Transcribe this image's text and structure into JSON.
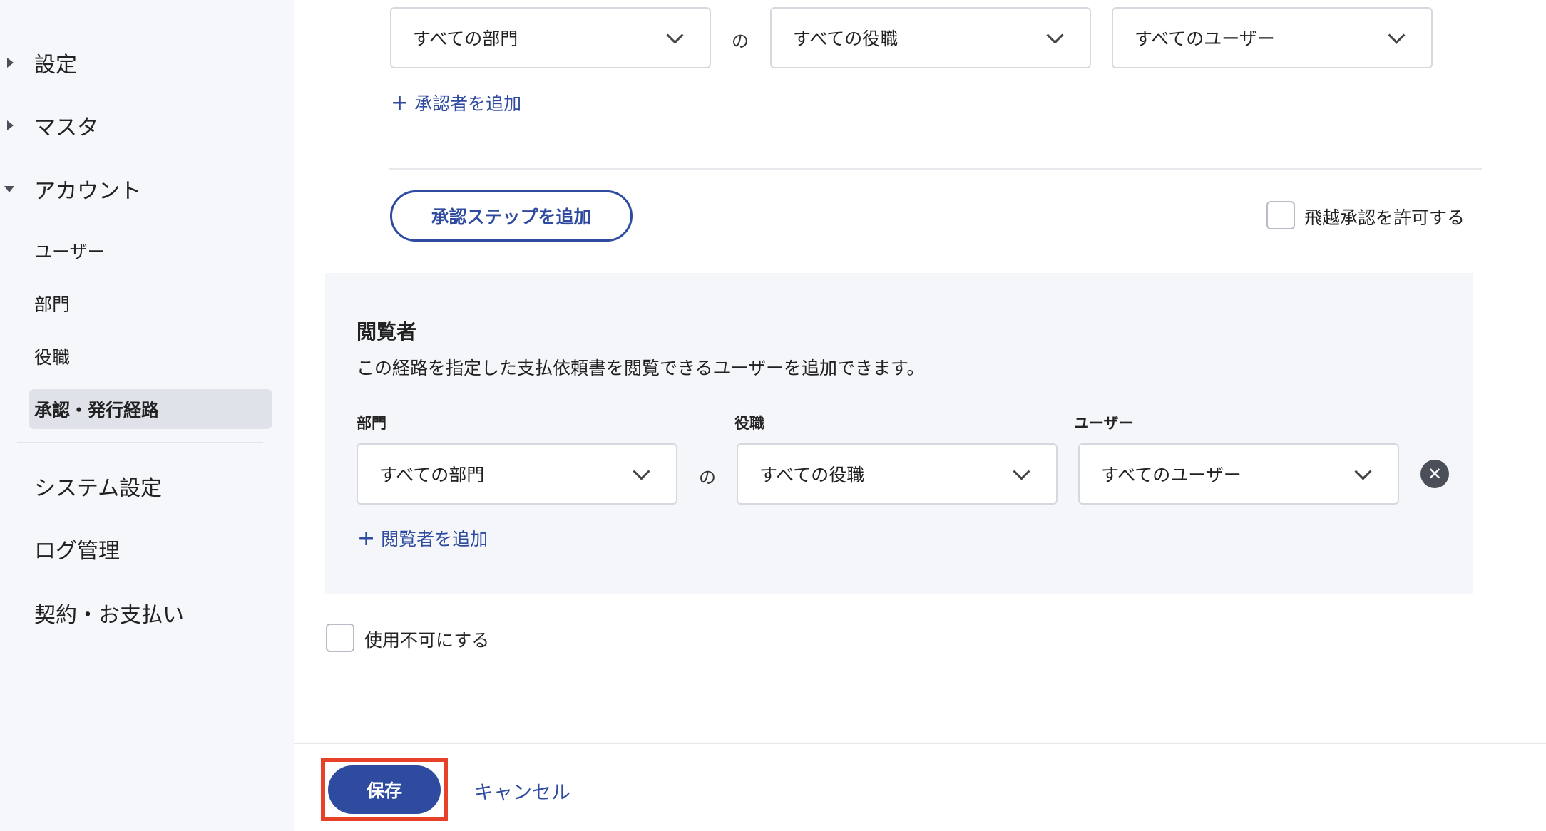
{
  "sidebar": {
    "groups": [
      {
        "label": "設定",
        "expanded": false
      },
      {
        "label": "マスタ",
        "expanded": false
      },
      {
        "label": "アカウント",
        "expanded": true
      }
    ],
    "account_items": [
      {
        "label": "ユーザー"
      },
      {
        "label": "部門"
      },
      {
        "label": "役職"
      },
      {
        "label": "承認・発行経路",
        "active": true
      }
    ],
    "bottom_items": [
      {
        "label": "システム設定"
      },
      {
        "label": "ログ管理"
      },
      {
        "label": "契約・お支払い"
      }
    ]
  },
  "approver_row": {
    "department": "すべての部門",
    "connector": "の",
    "position": "すべての役職",
    "user": "すべてのユーザー",
    "add_approver_label": "承認者を追加"
  },
  "add_step_label": "承認ステップを追加",
  "allow_skip_label": "飛越承認を許可する",
  "viewers": {
    "title": "閲覧者",
    "description": "この経路を指定した支払依頼書を閲覧できるユーザーを追加できます。",
    "col_department": "部門",
    "col_position": "役職",
    "col_user": "ユーザー",
    "department": "すべての部門",
    "connector": "の",
    "position": "すべての役職",
    "user": "すべてのユーザー",
    "add_viewer_label": "閲覧者を追加"
  },
  "disable_label": "使用不可にする",
  "footer": {
    "save_label": "保存",
    "cancel_label": "キャンセル"
  },
  "colors": {
    "accent": "#2f4ba0",
    "highlight": "#e8412a",
    "sidebar_bg": "#f6f7fa",
    "panel_bg": "#f5f6f9"
  },
  "icons": {
    "select": "chevron-down-icon",
    "add": "plus-icon",
    "remove": "close-circle-icon",
    "collapsed": "caret-right-icon",
    "expanded": "caret-down-icon"
  }
}
